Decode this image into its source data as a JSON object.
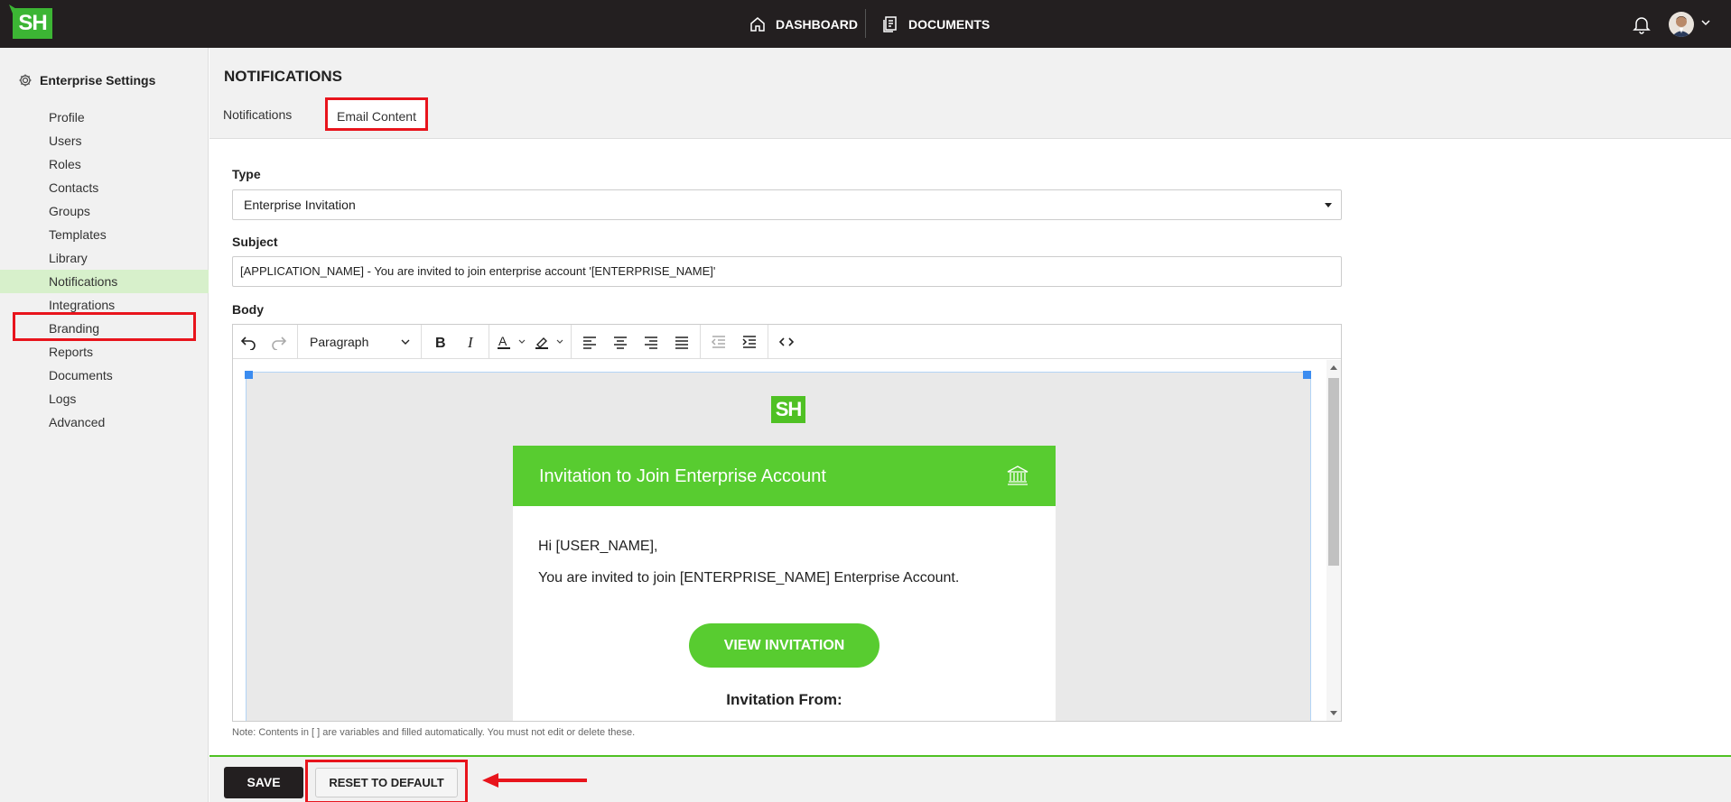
{
  "topbar": {
    "logo": "SH",
    "nav": [
      {
        "label": "DASHBOARD",
        "icon": "home-icon"
      },
      {
        "label": "DOCUMENTS",
        "icon": "documents-icon"
      }
    ]
  },
  "sidebar": {
    "heading": "Enterprise Settings",
    "items": [
      {
        "label": "Profile"
      },
      {
        "label": "Users"
      },
      {
        "label": "Roles"
      },
      {
        "label": "Contacts"
      },
      {
        "label": "Groups"
      },
      {
        "label": "Templates"
      },
      {
        "label": "Library"
      },
      {
        "label": "Notifications",
        "active": true
      },
      {
        "label": "Integrations"
      },
      {
        "label": "Branding"
      },
      {
        "label": "Reports"
      },
      {
        "label": "Documents"
      },
      {
        "label": "Logs"
      },
      {
        "label": "Advanced"
      }
    ]
  },
  "main": {
    "title": "NOTIFICATIONS",
    "tabs": [
      {
        "label": "Notifications"
      },
      {
        "label": "Email Content",
        "active": true
      }
    ],
    "type_label": "Type",
    "type_value": "Enterprise Invitation",
    "subject_label": "Subject",
    "subject_value": "[APPLICATION_NAME] - You are invited to join enterprise account '[ENTERPRISE_NAME]'",
    "body_label": "Body",
    "toolbar": {
      "block_format": "Paragraph"
    },
    "email": {
      "logo": "SH",
      "banner_title": "Invitation to Join Enterprise Account",
      "greeting": "Hi [USER_NAME],",
      "message": "You are invited to join [ENTERPRISE_NAME] Enterprise Account.",
      "button": "VIEW INVITATION",
      "from_label": "Invitation From:"
    },
    "note": "Note: Contents in [ ] are variables and filled automatically. You must not edit or delete these."
  },
  "footer": {
    "save": "SAVE",
    "reset": "RESET TO DEFAULT"
  },
  "colors": {
    "brand_green": "#58cc30",
    "topbar": "#231f20",
    "highlight_red": "#e8141c",
    "active_item": "#d7f0cb"
  }
}
